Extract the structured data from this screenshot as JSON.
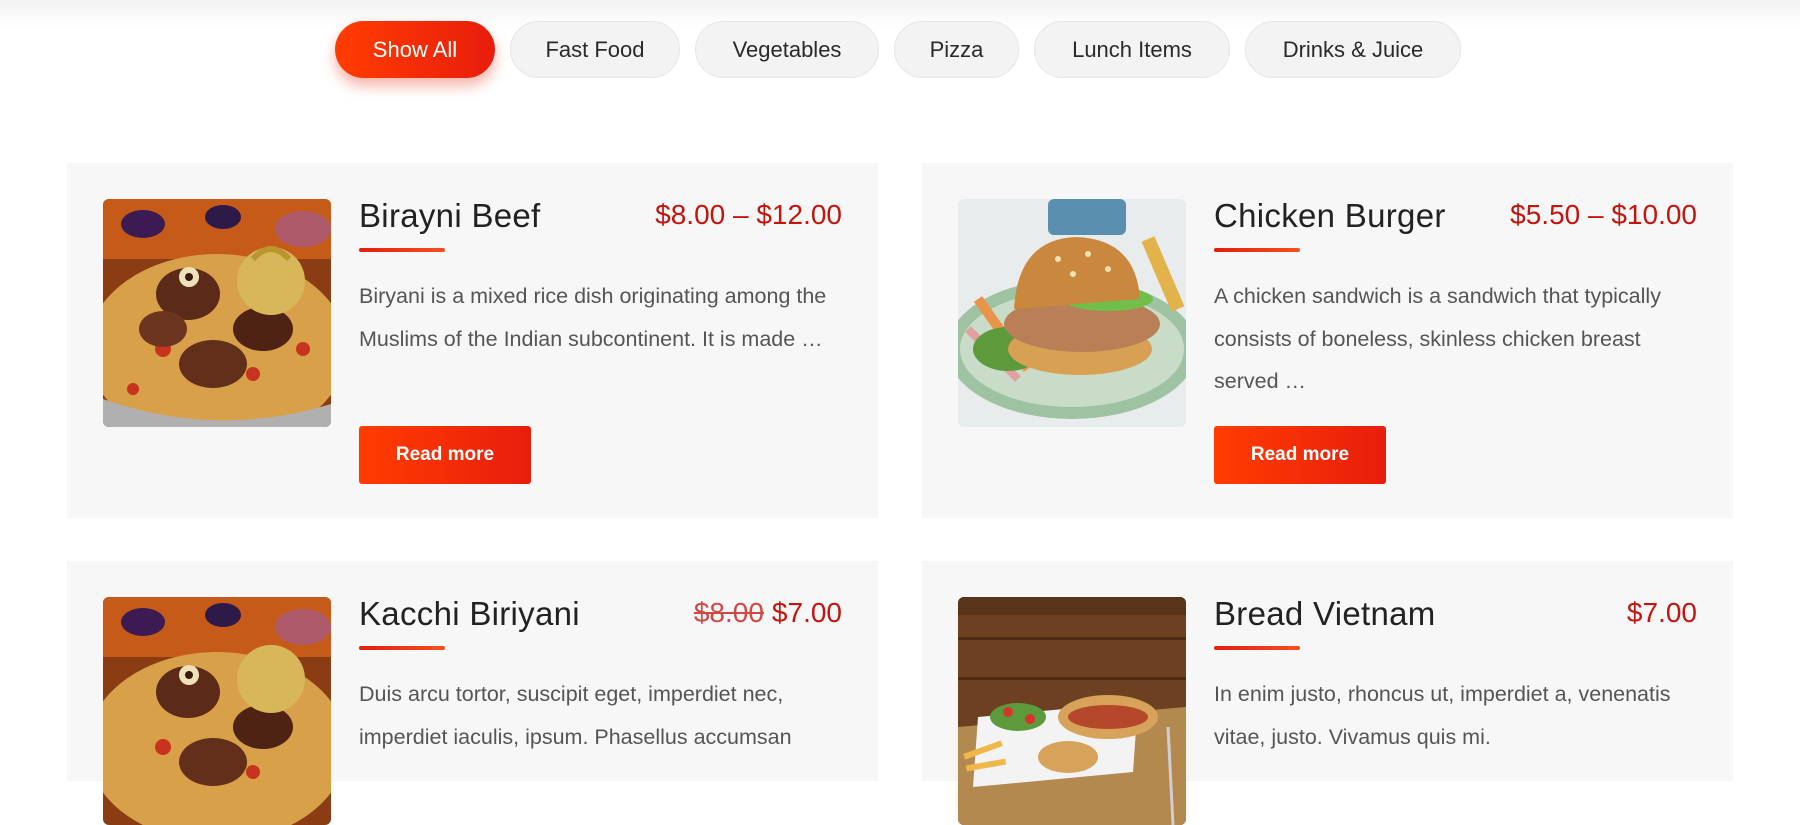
{
  "filters": [
    {
      "label": "Show All",
      "active": true
    },
    {
      "label": "Fast Food"
    },
    {
      "label": "Vegetables"
    },
    {
      "label": "Pizza"
    },
    {
      "label": "Lunch Items"
    },
    {
      "label": "Drinks & Juice"
    }
  ],
  "menu_items": [
    {
      "name": "Birayni Beef",
      "price": "$8.00 – $12.00",
      "old_price": "",
      "description": "Biryani is a mixed rice dish originating among the Muslims of the Indian subcontinent. It is made …",
      "button": "Read more",
      "image": "biryani-photo"
    },
    {
      "name": "Chicken Burger",
      "price": "$5.50 – $10.00",
      "old_price": "",
      "description": "A chicken sandwich is a sandwich that typically consists of boneless, skinless chicken breast served …",
      "button": "Read more",
      "image": "burger-photo"
    },
    {
      "name": "Kacchi Biriyani",
      "price": "$7.00",
      "old_price": "$8.00",
      "description": "Duis arcu tortor, suscipit eget, imperdiet nec, imperdiet iaculis, ipsum. Phasellus accumsan",
      "image": "biryani-photo"
    },
    {
      "name": "Bread Vietnam",
      "price": "$7.00",
      "old_price": "",
      "description": "In enim justo, rhoncus ut, imperdiet a, venenatis vitae, justo. Vivamus quis mi.",
      "image": "bread-photo"
    }
  ],
  "colors": {
    "accent": "#e81d0d",
    "price": "#c4140e",
    "card_bg": "#f7f7f7"
  }
}
